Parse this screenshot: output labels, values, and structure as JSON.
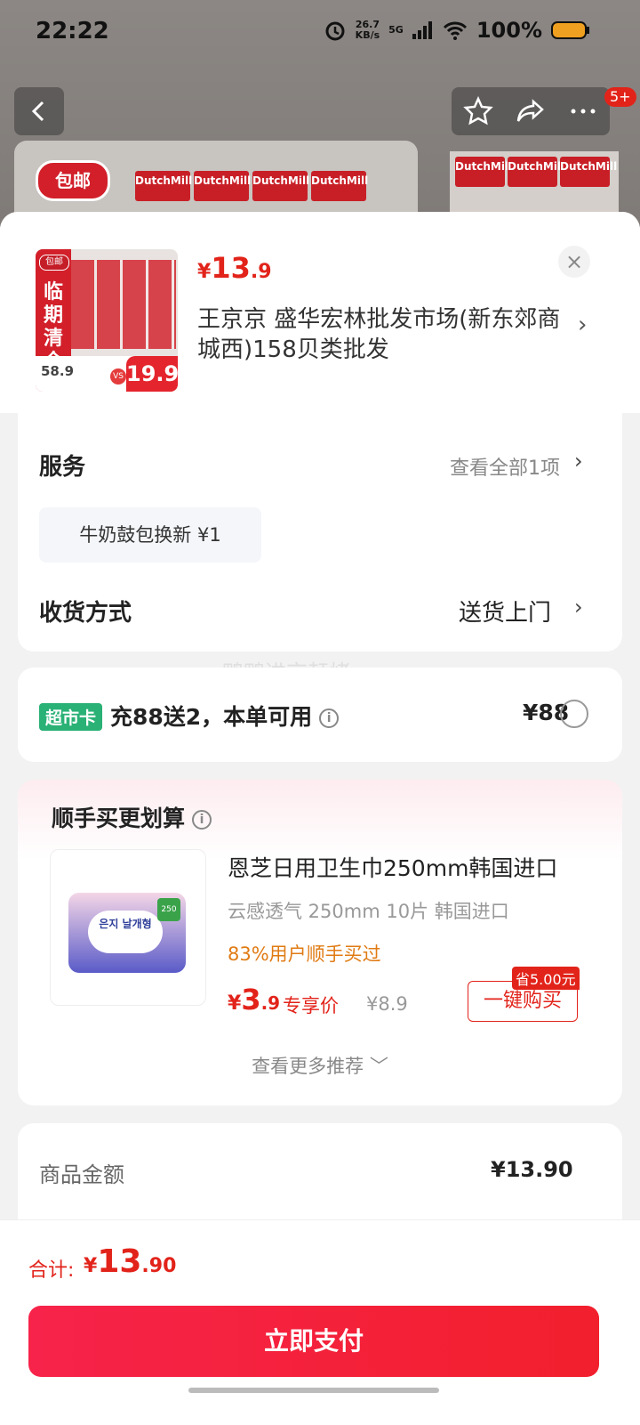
{
  "status_bar": {
    "time": "22:22",
    "net_speed_value": "26.7",
    "net_speed_unit": "KB/s",
    "network": "5G",
    "battery": "100%"
  },
  "nav": {
    "notifications_badge": "5+"
  },
  "background": {
    "free_shipping": "包邮",
    "brand": "DutchMill"
  },
  "sheet": {
    "product_thumb": {
      "badge": "包邮",
      "label": "临期清仓",
      "old_price": "58.9",
      "vs": "VS",
      "new_price": "19.9"
    },
    "price": {
      "currency": "¥",
      "integer": "13",
      "decimal": ".9"
    },
    "close_icon": "×",
    "shop_name": "王京京  盛华宏林批发市场(新东郊商城西)158贝类批发"
  },
  "service": {
    "label": "服务",
    "view_all": "查看全部1项",
    "chip": "牛奶鼓包换新  ¥1"
  },
  "delivery": {
    "label": "收货方式",
    "value": "送货上门"
  },
  "card_offer": {
    "badge": "超市卡",
    "text": "充88送2，本单可用",
    "price": "¥88"
  },
  "watermark": "鸭鸭进京赶烤",
  "recommend": {
    "title": "顺手买更划算",
    "product_name": "恩芝日用卫生巾250mm韩国进口",
    "pack_text": "은지 날개형",
    "pack_tag": "250",
    "desc": "云感透气 250mm 10片 韩国进口",
    "bought": "83%用户顺手买过",
    "price": {
      "currency": "¥",
      "integer": "3",
      "decimal": ".9"
    },
    "price_label": "专享价",
    "original_price": "¥8.9",
    "save_tag": "省5.00元",
    "buy_button": "一键购买",
    "more": "查看更多推荐 ﹀"
  },
  "amount": {
    "label": "商品金额",
    "value": "¥13.90"
  },
  "footer": {
    "total_label": "合计:",
    "total": {
      "currency": "¥",
      "integer": "13",
      "decimal": ".90"
    },
    "pay_button": "立即支付"
  },
  "colors": {
    "accent": "#e2231a",
    "supermarket_card": "#2ab176",
    "orange": "#e07b14"
  }
}
